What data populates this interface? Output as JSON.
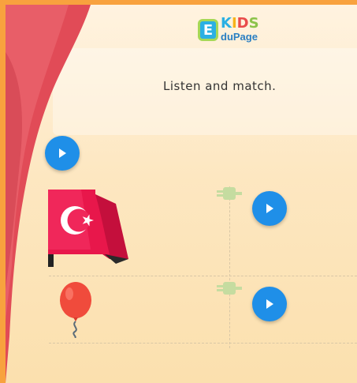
{
  "app": {
    "logo": {
      "letter": "E",
      "word_letters": [
        "K",
        "I",
        "D",
        "S"
      ],
      "subtitle": "duPage"
    }
  },
  "activity": {
    "instruction": "Listen and match.",
    "prompt_audio_icon": "play-icon",
    "items": [
      {
        "image": "turkish-flag-icon",
        "audio_icon": "play-icon"
      },
      {
        "image": "red-balloon-icon",
        "audio_icon": "play-icon"
      }
    ]
  },
  "colors": {
    "border": "#f8a23e",
    "play_button": "#1f8fe8",
    "plug": "#c5dca0",
    "flag_red": "#e8174b",
    "balloon_red": "#f04b3c"
  }
}
